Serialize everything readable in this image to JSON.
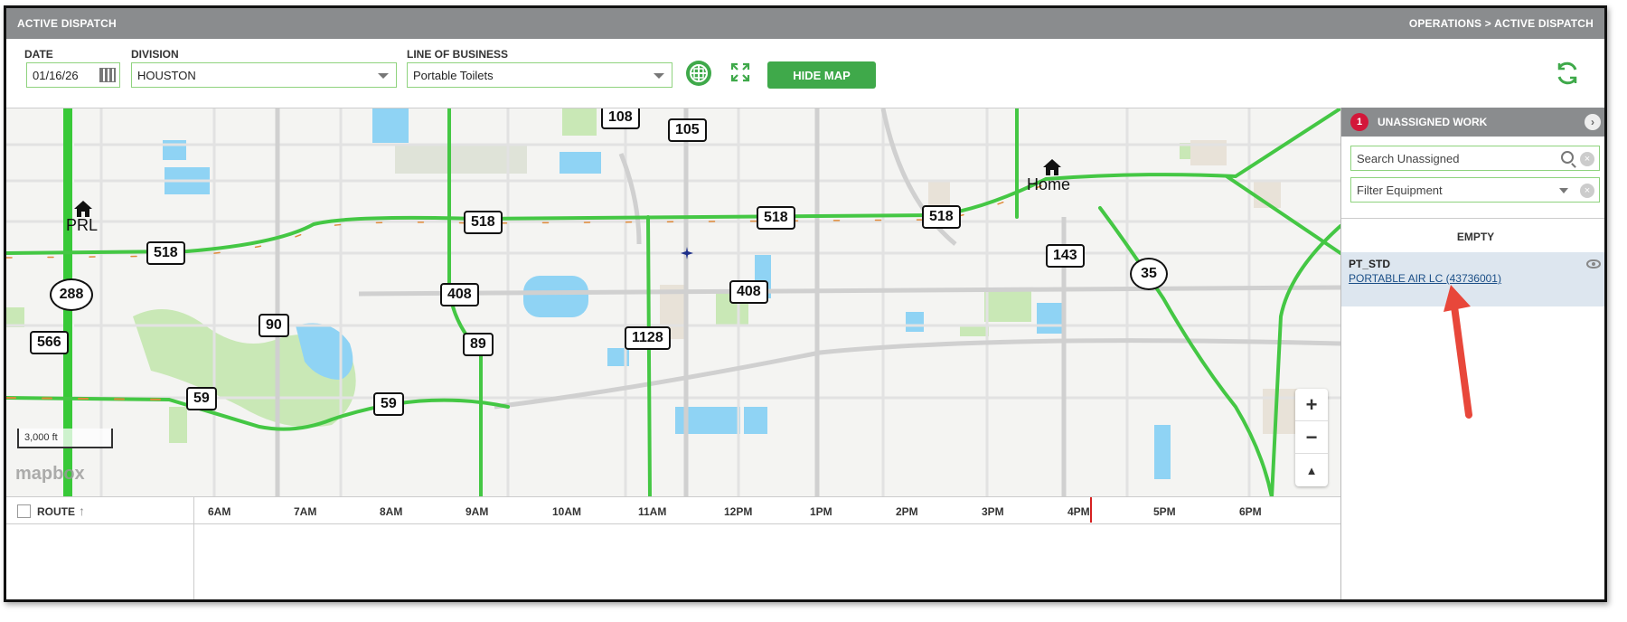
{
  "titlebar": {
    "title": "ACTIVE DISPATCH",
    "breadcrumb": "OPERATIONS > ACTIVE DISPATCH"
  },
  "toolbar": {
    "date_label": "DATE",
    "date_value": "01/16/26",
    "division_label": "DIVISION",
    "division_value": "HOUSTON",
    "lob_label": "LINE OF BUSINESS",
    "lob_value": "Portable Toilets",
    "hide_map_label": "HIDE MAP",
    "icons": [
      "map-layers-icon",
      "fullscreen-icon",
      "refresh-icon"
    ]
  },
  "map": {
    "shields": [
      "108",
      "105",
      "518",
      "518",
      "518",
      "518",
      "143",
      "35",
      "288",
      "408",
      "408",
      "566",
      "90",
      "89",
      "1128",
      "59",
      "59"
    ],
    "places": [
      "PRL",
      "Home"
    ],
    "scale_label": "3,000 ft",
    "attribution": "mapbox",
    "zoom_in": "+",
    "zoom_out": "−",
    "compass": "▲"
  },
  "timeline": {
    "route_label": "ROUTE",
    "hours": [
      "6AM",
      "7AM",
      "8AM",
      "9AM",
      "10AM",
      "11AM",
      "12PM",
      "1PM",
      "2PM",
      "3PM",
      "4PM",
      "5PM",
      "6PM"
    ]
  },
  "side": {
    "badge_count": "1",
    "title": "UNASSIGNED WORK",
    "search_placeholder": "Search Unassigned",
    "filter_placeholder": "Filter Equipment",
    "empty_label": "EMPTY",
    "item": {
      "type": "PT_STD",
      "customer": "PORTABLE AIR LC (43736001)"
    }
  },
  "colors": {
    "accent": "#3fa94a",
    "header": "#8a8c8e",
    "badge": "#d3173a",
    "annotation": "#e8473a"
  }
}
